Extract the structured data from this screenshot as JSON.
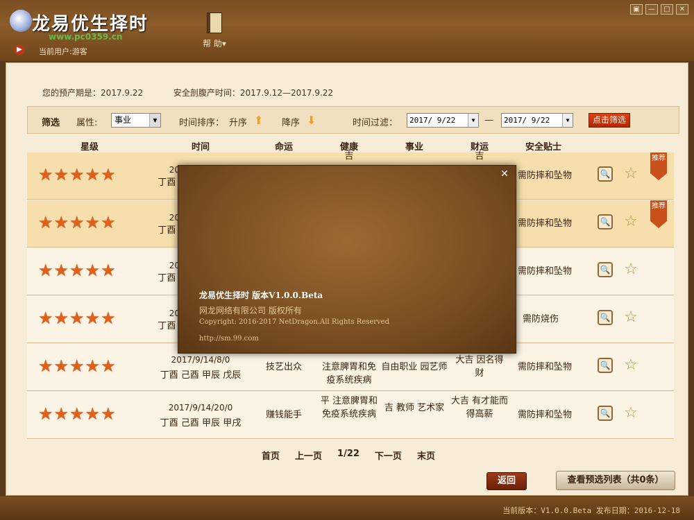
{
  "app": {
    "title": "龙易优生择时",
    "watermark": "www.pc0359.cn",
    "current_user": "当前用户:游客",
    "help_label": "帮 助▾",
    "win_controls": [
      "▣",
      "—",
      "□",
      "✕"
    ]
  },
  "due_info": {
    "due_date": "您的预产期是：2017.9.22",
    "safe_range": "安全剖腹产时间：2017.9.12—2017.9.22"
  },
  "filter": {
    "title": "筛选",
    "attr_label": "属性:",
    "attr_value": "事业",
    "sort_label": "时间排序：",
    "asc_label": "升序",
    "desc_label": "降序",
    "time_filter_label": "时间过滤：",
    "date_from": "2017/ 9/22",
    "date_sep": "—",
    "date_to": "2017/ 9/22",
    "button": "点击筛选"
  },
  "columns": [
    "星级",
    "时间",
    "命运",
    "健康",
    "事业",
    "财运",
    "安全贴士"
  ],
  "rows": [
    {
      "stars": "★★★★★",
      "date": "2017",
      "ganzhi": "丁酉 己",
      "fate": "",
      "health": "吉",
      "career": "",
      "wealth": "吉",
      "tip": "需防摔和坠物",
      "recommended": true,
      "highlight": true
    },
    {
      "stars": "★★★★★",
      "date": "2017",
      "ganzhi": "丁酉 己",
      "fate": "",
      "health": "",
      "career": "",
      "wealth": "",
      "tip": "需防摔和坠物",
      "recommended": true,
      "highlight": true
    },
    {
      "stars": "★★★★★",
      "date": "2017",
      "ganzhi": "丁酉 己",
      "fate": "",
      "health": "",
      "career": "",
      "wealth": "",
      "tip": "需防摔和坠物",
      "recommended": false,
      "highlight": false
    },
    {
      "stars": "★★★★★",
      "date": "2017",
      "ganzhi": "丁酉 己",
      "fate": "",
      "health": "",
      "career": "",
      "wealth": "",
      "tip": "需防烧伤",
      "recommended": false,
      "highlight": false
    },
    {
      "stars": "★★★★★",
      "date": "2017/9/14/8/0",
      "ganzhi": "丁酉 己酉 甲辰 戊辰",
      "fate": "技艺出众",
      "health": "注意脾胃和免疫系统疾病",
      "career": "自由职业 园艺师",
      "wealth": "大吉 因名得财",
      "tip": "需防摔和坠物",
      "recommended": false,
      "highlight": false
    },
    {
      "stars": "★★★★★",
      "date": "2017/9/14/20/0",
      "ganzhi": "丁酉 己酉 甲辰 甲戌",
      "fate": "赚钱能手",
      "health": "平 注意脾胃和免疫系统疾病",
      "career": "吉 教师 艺术家",
      "wealth": "大吉 有才能而得高薪",
      "tip": "需防摔和坠物",
      "recommended": false,
      "highlight": false
    }
  ],
  "badge": "推荐",
  "pager": {
    "first": "首页",
    "prev": "上一页",
    "page": "1/22",
    "next": "下一页",
    "last": "末页"
  },
  "actions": {
    "back": "返回",
    "list": "查看预选列表（共0条）"
  },
  "status": "当前版本：V1.0.0.Beta  发布日期：2016-12-18",
  "about": {
    "version": "龙易优生择时 版本V1.0.0.Beta",
    "company": "网龙网络有限公司 版权所有",
    "copyright": "Copyright:  2016-2017 NetDragon.All Rights Reserved",
    "url": "http://sm.99.com"
  },
  "colors": {
    "accent": "#e0601a",
    "frame": "#7a4e22",
    "highlight_row": "#f6dfac"
  }
}
